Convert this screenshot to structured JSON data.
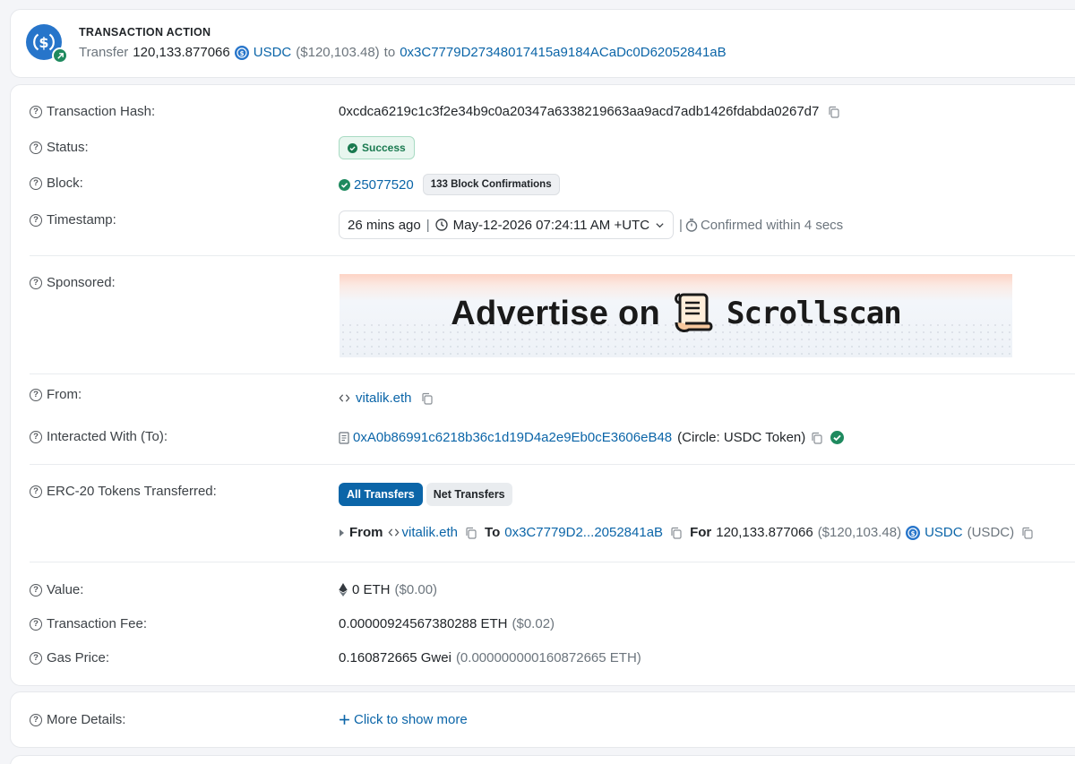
{
  "action": {
    "title": "TRANSACTION ACTION",
    "verb": "Transfer",
    "amount": "120,133.877066",
    "token": "USDC",
    "usd": "($120,103.48)",
    "to_word": "to",
    "to_address": "0x3C7779D27348017415a9184ACaDc0D62052841aB"
  },
  "rows": {
    "hash": {
      "label": "Transaction Hash:",
      "value": "0xcdca6219c1c3f2e34b9c0a20347a6338219663aa9acd7adb1426fdabda0267d7"
    },
    "status": {
      "label": "Status:",
      "value": "Success"
    },
    "block": {
      "label": "Block:",
      "number": "25077520",
      "confirmations": "133 Block Confirmations"
    },
    "timestamp": {
      "label": "Timestamp:",
      "ago": "26 mins ago",
      "sep": "|",
      "date": "May-12-2026 07:24:11 AM +UTC",
      "confirmed": "Confirmed within 4 secs"
    },
    "sponsored": {
      "label": "Sponsored:",
      "banner_text": "Advertise on",
      "banner_brand": "Scrollscan"
    },
    "from": {
      "label": "From:",
      "value": "vitalik.eth"
    },
    "interacted": {
      "label": "Interacted With (To):",
      "address": "0xA0b86991c6218b36c1d19D4a2e9Eb0cE3606eB48",
      "name": "(Circle: USDC Token)"
    },
    "erc20": {
      "label": "ERC-20 Tokens Transferred:",
      "tab_all": "All Transfers",
      "tab_net": "Net Transfers",
      "from_word": "From",
      "from_value": "vitalik.eth",
      "to_word": "To",
      "to_value": "0x3C7779D2...2052841aB",
      "for_word": "For",
      "amount": "120,133.877066",
      "usd": "($120,103.48)",
      "token": "USDC",
      "symbol": "(USDC)"
    },
    "value": {
      "label": "Value:",
      "amount": "0 ETH",
      "usd": "($0.00)"
    },
    "fee": {
      "label": "Transaction Fee:",
      "amount": "0.00000924567380288 ETH",
      "usd": "($0.02)"
    },
    "gas": {
      "label": "Gas Price:",
      "amount": "0.160872665 Gwei",
      "eth": "(0.000000000160872665 ETH)"
    }
  },
  "more": {
    "label": "More Details:",
    "link": "Click to show more"
  },
  "colors": {
    "link": "#0b65a8",
    "success": "#1f8a5f",
    "usdc": "#2775ca"
  }
}
